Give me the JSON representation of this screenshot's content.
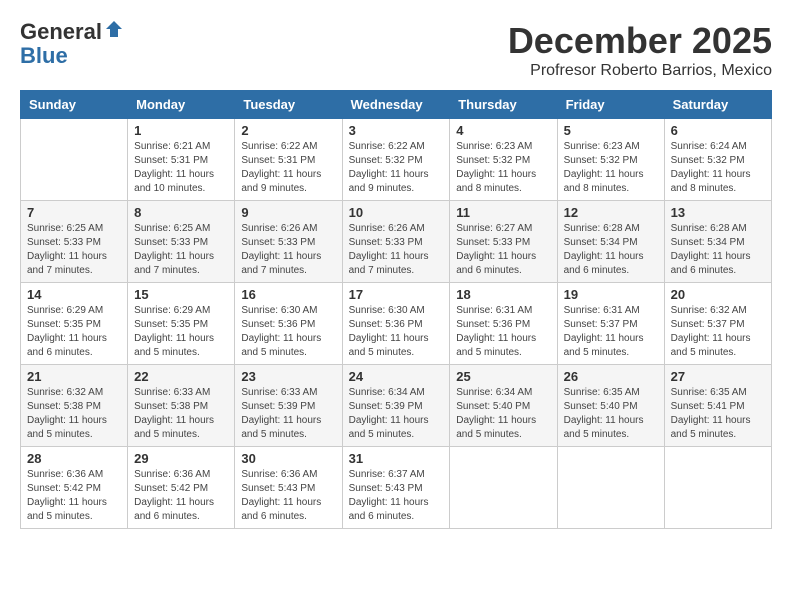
{
  "header": {
    "logo_general": "General",
    "logo_blue": "Blue",
    "month_title": "December 2025",
    "subtitle": "Profresor Roberto Barrios, Mexico"
  },
  "weekdays": [
    "Sunday",
    "Monday",
    "Tuesday",
    "Wednesday",
    "Thursday",
    "Friday",
    "Saturday"
  ],
  "weeks": [
    [
      {
        "day": "",
        "info": ""
      },
      {
        "day": "1",
        "info": "Sunrise: 6:21 AM\nSunset: 5:31 PM\nDaylight: 11 hours\nand 10 minutes."
      },
      {
        "day": "2",
        "info": "Sunrise: 6:22 AM\nSunset: 5:31 PM\nDaylight: 11 hours\nand 9 minutes."
      },
      {
        "day": "3",
        "info": "Sunrise: 6:22 AM\nSunset: 5:32 PM\nDaylight: 11 hours\nand 9 minutes."
      },
      {
        "day": "4",
        "info": "Sunrise: 6:23 AM\nSunset: 5:32 PM\nDaylight: 11 hours\nand 8 minutes."
      },
      {
        "day": "5",
        "info": "Sunrise: 6:23 AM\nSunset: 5:32 PM\nDaylight: 11 hours\nand 8 minutes."
      },
      {
        "day": "6",
        "info": "Sunrise: 6:24 AM\nSunset: 5:32 PM\nDaylight: 11 hours\nand 8 minutes."
      }
    ],
    [
      {
        "day": "7",
        "info": "Sunrise: 6:25 AM\nSunset: 5:33 PM\nDaylight: 11 hours\nand 7 minutes."
      },
      {
        "day": "8",
        "info": "Sunrise: 6:25 AM\nSunset: 5:33 PM\nDaylight: 11 hours\nand 7 minutes."
      },
      {
        "day": "9",
        "info": "Sunrise: 6:26 AM\nSunset: 5:33 PM\nDaylight: 11 hours\nand 7 minutes."
      },
      {
        "day": "10",
        "info": "Sunrise: 6:26 AM\nSunset: 5:33 PM\nDaylight: 11 hours\nand 7 minutes."
      },
      {
        "day": "11",
        "info": "Sunrise: 6:27 AM\nSunset: 5:33 PM\nDaylight: 11 hours\nand 6 minutes."
      },
      {
        "day": "12",
        "info": "Sunrise: 6:28 AM\nSunset: 5:34 PM\nDaylight: 11 hours\nand 6 minutes."
      },
      {
        "day": "13",
        "info": "Sunrise: 6:28 AM\nSunset: 5:34 PM\nDaylight: 11 hours\nand 6 minutes."
      }
    ],
    [
      {
        "day": "14",
        "info": "Sunrise: 6:29 AM\nSunset: 5:35 PM\nDaylight: 11 hours\nand 6 minutes."
      },
      {
        "day": "15",
        "info": "Sunrise: 6:29 AM\nSunset: 5:35 PM\nDaylight: 11 hours\nand 5 minutes."
      },
      {
        "day": "16",
        "info": "Sunrise: 6:30 AM\nSunset: 5:36 PM\nDaylight: 11 hours\nand 5 minutes."
      },
      {
        "day": "17",
        "info": "Sunrise: 6:30 AM\nSunset: 5:36 PM\nDaylight: 11 hours\nand 5 minutes."
      },
      {
        "day": "18",
        "info": "Sunrise: 6:31 AM\nSunset: 5:36 PM\nDaylight: 11 hours\nand 5 minutes."
      },
      {
        "day": "19",
        "info": "Sunrise: 6:31 AM\nSunset: 5:37 PM\nDaylight: 11 hours\nand 5 minutes."
      },
      {
        "day": "20",
        "info": "Sunrise: 6:32 AM\nSunset: 5:37 PM\nDaylight: 11 hours\nand 5 minutes."
      }
    ],
    [
      {
        "day": "21",
        "info": "Sunrise: 6:32 AM\nSunset: 5:38 PM\nDaylight: 11 hours\nand 5 minutes."
      },
      {
        "day": "22",
        "info": "Sunrise: 6:33 AM\nSunset: 5:38 PM\nDaylight: 11 hours\nand 5 minutes."
      },
      {
        "day": "23",
        "info": "Sunrise: 6:33 AM\nSunset: 5:39 PM\nDaylight: 11 hours\nand 5 minutes."
      },
      {
        "day": "24",
        "info": "Sunrise: 6:34 AM\nSunset: 5:39 PM\nDaylight: 11 hours\nand 5 minutes."
      },
      {
        "day": "25",
        "info": "Sunrise: 6:34 AM\nSunset: 5:40 PM\nDaylight: 11 hours\nand 5 minutes."
      },
      {
        "day": "26",
        "info": "Sunrise: 6:35 AM\nSunset: 5:40 PM\nDaylight: 11 hours\nand 5 minutes."
      },
      {
        "day": "27",
        "info": "Sunrise: 6:35 AM\nSunset: 5:41 PM\nDaylight: 11 hours\nand 5 minutes."
      }
    ],
    [
      {
        "day": "28",
        "info": "Sunrise: 6:36 AM\nSunset: 5:42 PM\nDaylight: 11 hours\nand 5 minutes."
      },
      {
        "day": "29",
        "info": "Sunrise: 6:36 AM\nSunset: 5:42 PM\nDaylight: 11 hours\nand 6 minutes."
      },
      {
        "day": "30",
        "info": "Sunrise: 6:36 AM\nSunset: 5:43 PM\nDaylight: 11 hours\nand 6 minutes."
      },
      {
        "day": "31",
        "info": "Sunrise: 6:37 AM\nSunset: 5:43 PM\nDaylight: 11 hours\nand 6 minutes."
      },
      {
        "day": "",
        "info": ""
      },
      {
        "day": "",
        "info": ""
      },
      {
        "day": "",
        "info": ""
      }
    ]
  ]
}
